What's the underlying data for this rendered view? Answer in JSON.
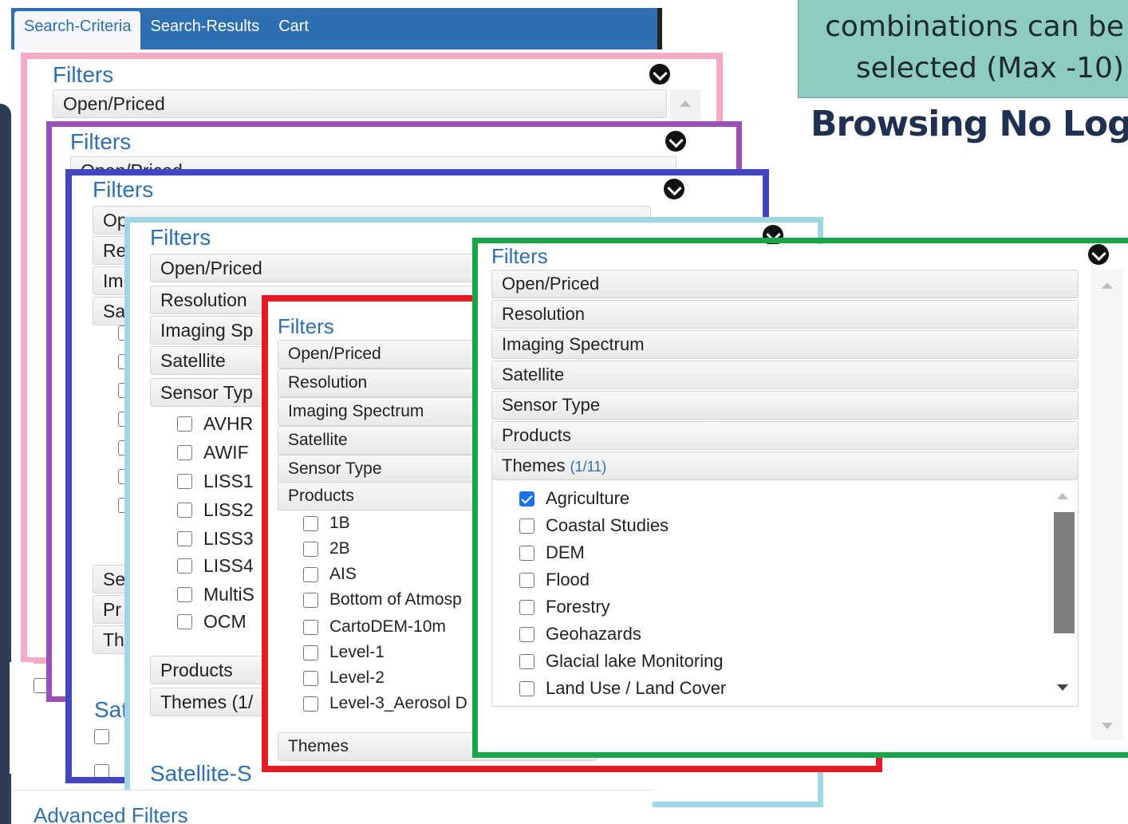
{
  "tabs": [
    {
      "label": "Search-Criteria",
      "active": true
    },
    {
      "label": "Search-Results",
      "active": false
    },
    {
      "label": "Cart",
      "active": false
    }
  ],
  "callout": {
    "line1": "combinations can be",
    "line2": "selected (Max -10)",
    "note": "Browsing No Login"
  },
  "colors": {
    "pink": "#f4a9c6",
    "purple": "#9b4fb8",
    "indigo": "#4244c0",
    "lightblue": "#9fd6e8",
    "red": "#e21b25",
    "green": "#1aa648",
    "tab_blue": "#2d6fb0"
  },
  "panel_pink": {
    "title": "Filters",
    "sections": [
      "Open/Priced"
    ]
  },
  "panel_purple": {
    "title": "Filters",
    "sections": [
      "Open/Priced"
    ]
  },
  "panel_indigo": {
    "title": "Filters",
    "sections": [
      "Op",
      "Re",
      "Im",
      "Sa",
      "Se",
      "Pr",
      "Th"
    ],
    "footer": "Sat"
  },
  "panel_lightblue": {
    "title": "Filters",
    "sections": [
      "Open/Priced",
      "Resolution",
      "Imaging Sp",
      "Satellite",
      "Sensor Typ"
    ],
    "sensors": [
      "AVHR",
      "AWIF",
      "LISS1",
      "LISS2",
      "LISS3",
      "LISS4",
      "MultiS",
      "OCM"
    ],
    "products": "Products",
    "themes": "Themes (1/",
    "footer": "Satellite-S",
    "bottom_text": "Advanced Filters"
  },
  "panel_red": {
    "title": "Filters",
    "sections": [
      "Open/Priced",
      "Resolution",
      "Imaging Spectrum",
      "Satellite",
      "Sensor Type",
      "Products"
    ],
    "products": [
      "1B",
      "2B",
      "AIS",
      "Bottom of Atmosp",
      "CartoDEM-10m",
      "Level-1",
      "Level-2",
      "Level-3_Aerosol D"
    ],
    "themes": "Themes"
  },
  "panel_green": {
    "title": "Filters",
    "sections": [
      "Open/Priced",
      "Resolution",
      "Imaging Spectrum",
      "Satellite",
      "Sensor Type",
      "Products"
    ],
    "themes_label": "Themes",
    "themes_count": "(1/11)",
    "themes": [
      {
        "label": "Agriculture",
        "checked": true
      },
      {
        "label": "Coastal Studies",
        "checked": false
      },
      {
        "label": "DEM",
        "checked": false
      },
      {
        "label": "Flood",
        "checked": false
      },
      {
        "label": "Forestry",
        "checked": false
      },
      {
        "label": "Geohazards",
        "checked": false
      },
      {
        "label": "Glacial lake Monitoring",
        "checked": false
      },
      {
        "label": "Land Use / Land Cover",
        "checked": false
      }
    ]
  }
}
